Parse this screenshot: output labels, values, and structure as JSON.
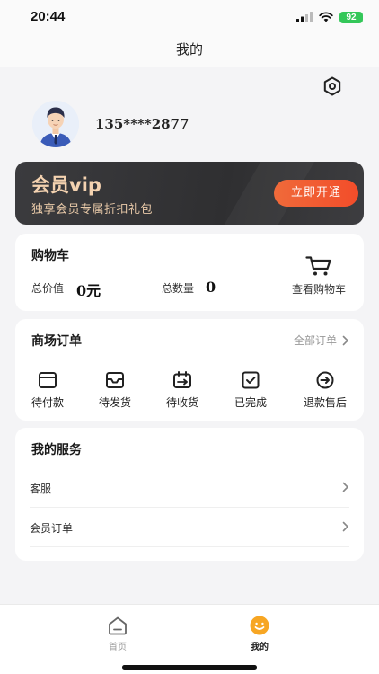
{
  "status": {
    "time": "20:44",
    "battery": "92"
  },
  "nav": {
    "title": "我的"
  },
  "profile": {
    "phone": "135****2877"
  },
  "vip": {
    "title": "会员vip",
    "subtitle": "独享会员专属折扣礼包",
    "button_label": "立即开通"
  },
  "cart": {
    "title": "购物车",
    "total_value_label": "总价值",
    "total_value": "0元",
    "total_count_label": "总数量",
    "total_count": "0",
    "view_label": "查看购物车"
  },
  "orders": {
    "title": "商场订单",
    "all_label": "全部订单",
    "items": [
      {
        "label": "待付款",
        "icon": "wallet-icon"
      },
      {
        "label": "待发货",
        "icon": "inbox-icon"
      },
      {
        "label": "待收货",
        "icon": "delivery-icon"
      },
      {
        "label": "已完成",
        "icon": "check-icon"
      },
      {
        "label": "退款售后",
        "icon": "refund-icon"
      }
    ]
  },
  "services": {
    "title": "我的服务",
    "items": [
      {
        "label": "客服"
      },
      {
        "label": "会员订单"
      }
    ]
  },
  "tabs": [
    {
      "label": "首页",
      "icon": "home-icon",
      "active": false
    },
    {
      "label": "我的",
      "icon": "smiley-icon",
      "active": true
    }
  ],
  "colors": {
    "accent": "#f05a32",
    "vip_text": "#f4d2b0",
    "tab_active": "#f7a623"
  }
}
